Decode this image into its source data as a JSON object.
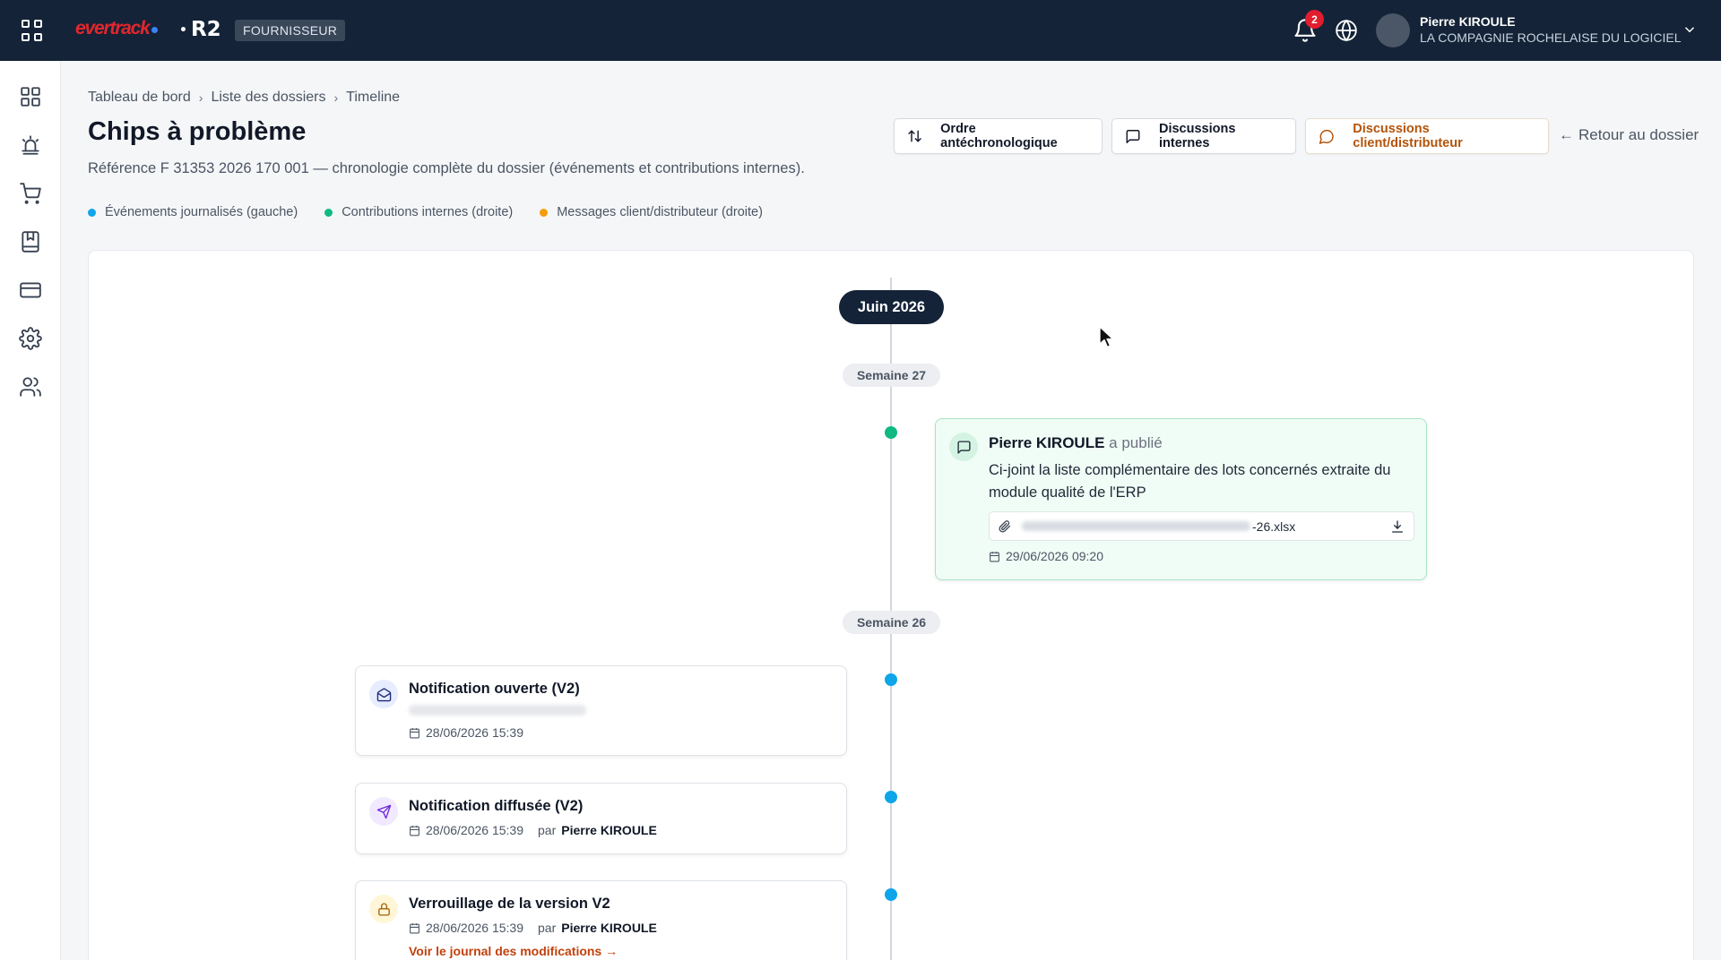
{
  "header": {
    "logo_text_1": "ever",
    "logo_text_2": "track",
    "product": "R2",
    "role": "FOURNISSEUR",
    "notifications_count": "2",
    "user_name": "Pierre KIROULE",
    "user_company": "LA COMPAGNIE ROCHELAISE DU LOGICIEL",
    "icons": [
      "apps-grid-icon",
      "bell-icon",
      "globe-icon",
      "chevron-down-icon"
    ]
  },
  "sidebar": {
    "items": [
      {
        "name": "dashboard",
        "icon": "grid-icon"
      },
      {
        "name": "alerts",
        "icon": "siren-icon"
      },
      {
        "name": "cart",
        "icon": "cart-icon"
      },
      {
        "name": "catalog",
        "icon": "book-icon"
      },
      {
        "name": "billing",
        "icon": "card-icon"
      },
      {
        "name": "settings",
        "icon": "gear-icon"
      },
      {
        "name": "users",
        "icon": "users-icon"
      }
    ]
  },
  "breadcrumb": [
    "Tableau de bord",
    "Liste des dossiers",
    "Timeline"
  ],
  "page": {
    "title": "Chips à problème",
    "subtitle": "Référence F 31353 2026 170 001 — chronologie complète du dossier (événements et contributions internes)."
  },
  "toolbar": {
    "order_label": "Ordre antéchronologique",
    "internal_label": "Discussions internes",
    "client_label": "Discussions client/distributeur",
    "back_label": "Retour au dossier"
  },
  "legend": [
    {
      "label": "Événements journalisés (gauche)",
      "color": "#0ea5e9"
    },
    {
      "label": "Contributions internes (droite)",
      "color": "#10b981"
    },
    {
      "label": "Messages client/distributeur (droite)",
      "color": "#f59e0b"
    }
  ],
  "timeline": {
    "month": "Juin 2026",
    "weeks": [
      "Semaine 27",
      "Semaine 26"
    ],
    "post": {
      "author": "Pierre KIROULE",
      "action": "a publié",
      "body": "Ci-joint la liste complémentaire des lots concernés extraite du module qualité de l'ERP",
      "attachment_suffix": "-26.xlsx",
      "date": "29/06/2026 09:20"
    },
    "events": [
      {
        "title": "Notification ouverte (V2)",
        "date": "28/06/2026 15:39"
      },
      {
        "title": "Notification diffusée (V2)",
        "date": "28/06/2026 15:39",
        "by_label": "par",
        "by": "Pierre KIROULE"
      },
      {
        "title": "Verrouillage de la version V2",
        "date": "28/06/2026 15:39",
        "by_label": "par",
        "by": "Pierre KIROULE",
        "link": "Voir le journal des modifications →"
      }
    ]
  }
}
